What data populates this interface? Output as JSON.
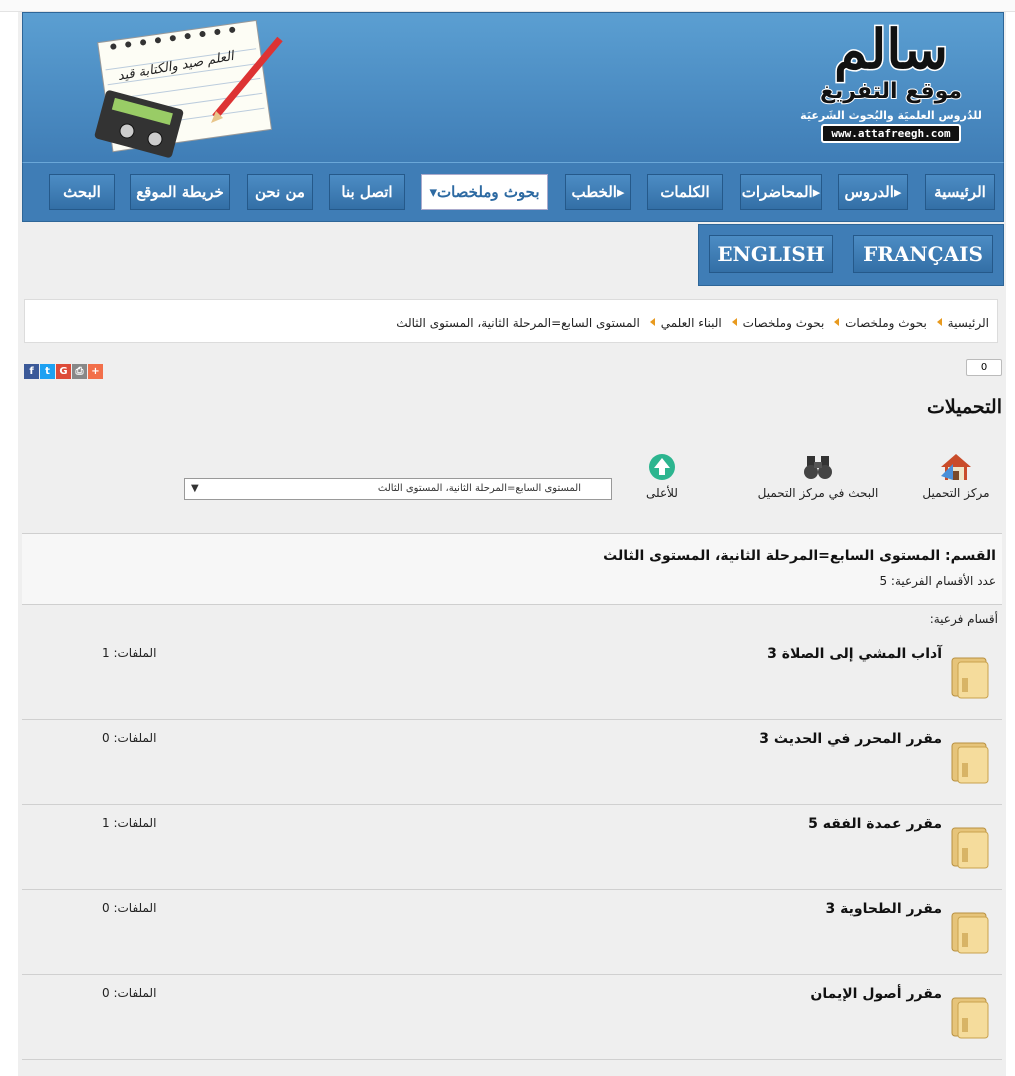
{
  "header": {
    "logo_big": "سالم",
    "logo_mid": "موقع التفريغ",
    "logo_sub": "للدُروس العلميَة والبُحوث الشَرعيَة",
    "logo_url": "www.attafreegh.com",
    "note_text": "العلم صيد والكتابة قيد"
  },
  "nav": {
    "items": [
      "الرئيسية",
      "الدروس",
      "المحاضرات",
      "الكلمات",
      "الخطب",
      "بحوث وملخصات",
      "اتصل بنا",
      "من نحن",
      "خريطة الموقع",
      "البحث"
    ]
  },
  "lang": {
    "fr": "FRANÇAIS",
    "en": "ENGLISH"
  },
  "breadcrumb": [
    "الرئيسية",
    "بحوث وملخصات",
    "بحوث وملخصات",
    "البناء العلمي",
    "المستوى السابع=المرحلة الثانية، المستوى الثالث"
  ],
  "share": {
    "counter": "0"
  },
  "page_title": "التحميلات",
  "tools": {
    "center": "مركز التحميل",
    "search": "البحث في مركز التحميل",
    "top": "للأعلى",
    "select_value": "المستوى السابع=المرحلة الثانية، المستوى الثالث"
  },
  "category": {
    "name": "القسم: المستوى السابع=المرحلة الثانية، المستوى الثالث",
    "count": "عدد الأقسام الفرعية: 5"
  },
  "subsections_label": "أقسام فرعية:",
  "rows": [
    {
      "name": "آداب المشي إلى الصلاة 3",
      "files": "الملفات: 1"
    },
    {
      "name": "مقرر المحرر في الحديث 3",
      "files": "الملفات: 0"
    },
    {
      "name": "مقرر عمدة الفقه 5",
      "files": "الملفات: 1"
    },
    {
      "name": "مقرر الطحاوية 3",
      "files": "الملفات: 0"
    },
    {
      "name": "مقرر أصول الإيمان",
      "files": "الملفات: 0"
    }
  ]
}
